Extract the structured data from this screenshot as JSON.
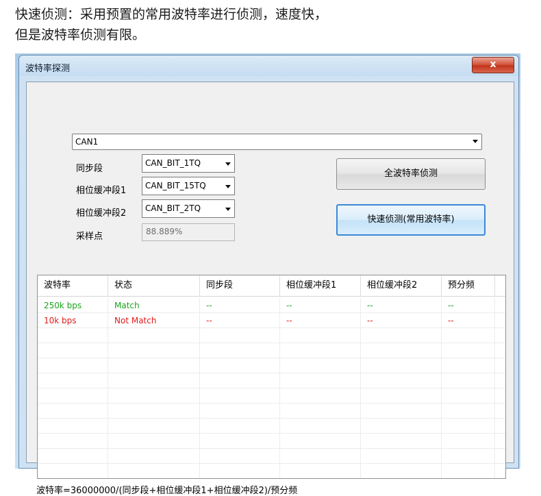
{
  "caption": {
    "line1": "快速侦测：采用预置的常用波特率进行侦测，速度快，",
    "line2": "但是波特率侦测有限。"
  },
  "window": {
    "title": "波特率探测",
    "close_label": "x"
  },
  "channel": {
    "selected": "CAN1"
  },
  "settings": {
    "sync_label": "同步段",
    "sync_value": "CAN_BIT_1TQ",
    "pb1_label": "相位缓冲段1",
    "pb1_value": "CAN_BIT_15TQ",
    "pb2_label": "相位缓冲段2",
    "pb2_value": "CAN_BIT_2TQ",
    "sample_label": "采样点",
    "sample_value": "88.889%"
  },
  "buttons": {
    "full_detect": "全波特率侦测",
    "quick_detect": "快速侦测(常用波特率)"
  },
  "table": {
    "headers": [
      "波特率",
      "状态",
      "同步段",
      "相位缓冲段1",
      "相位缓冲段2",
      "预分频"
    ],
    "rows": [
      [
        "250k  bps",
        "Match",
        "--",
        "--",
        "--",
        "--"
      ],
      [
        "10k   bps",
        "Not Match",
        "--",
        "--",
        "--",
        "--"
      ]
    ]
  },
  "formula": "波特率=36000000/(同步段+相位缓冲段1+相位缓冲段2)/预分频",
  "colors": {
    "match": "#1aa51a",
    "not_match": "#e01b1b",
    "focus": "#3a88d6"
  }
}
